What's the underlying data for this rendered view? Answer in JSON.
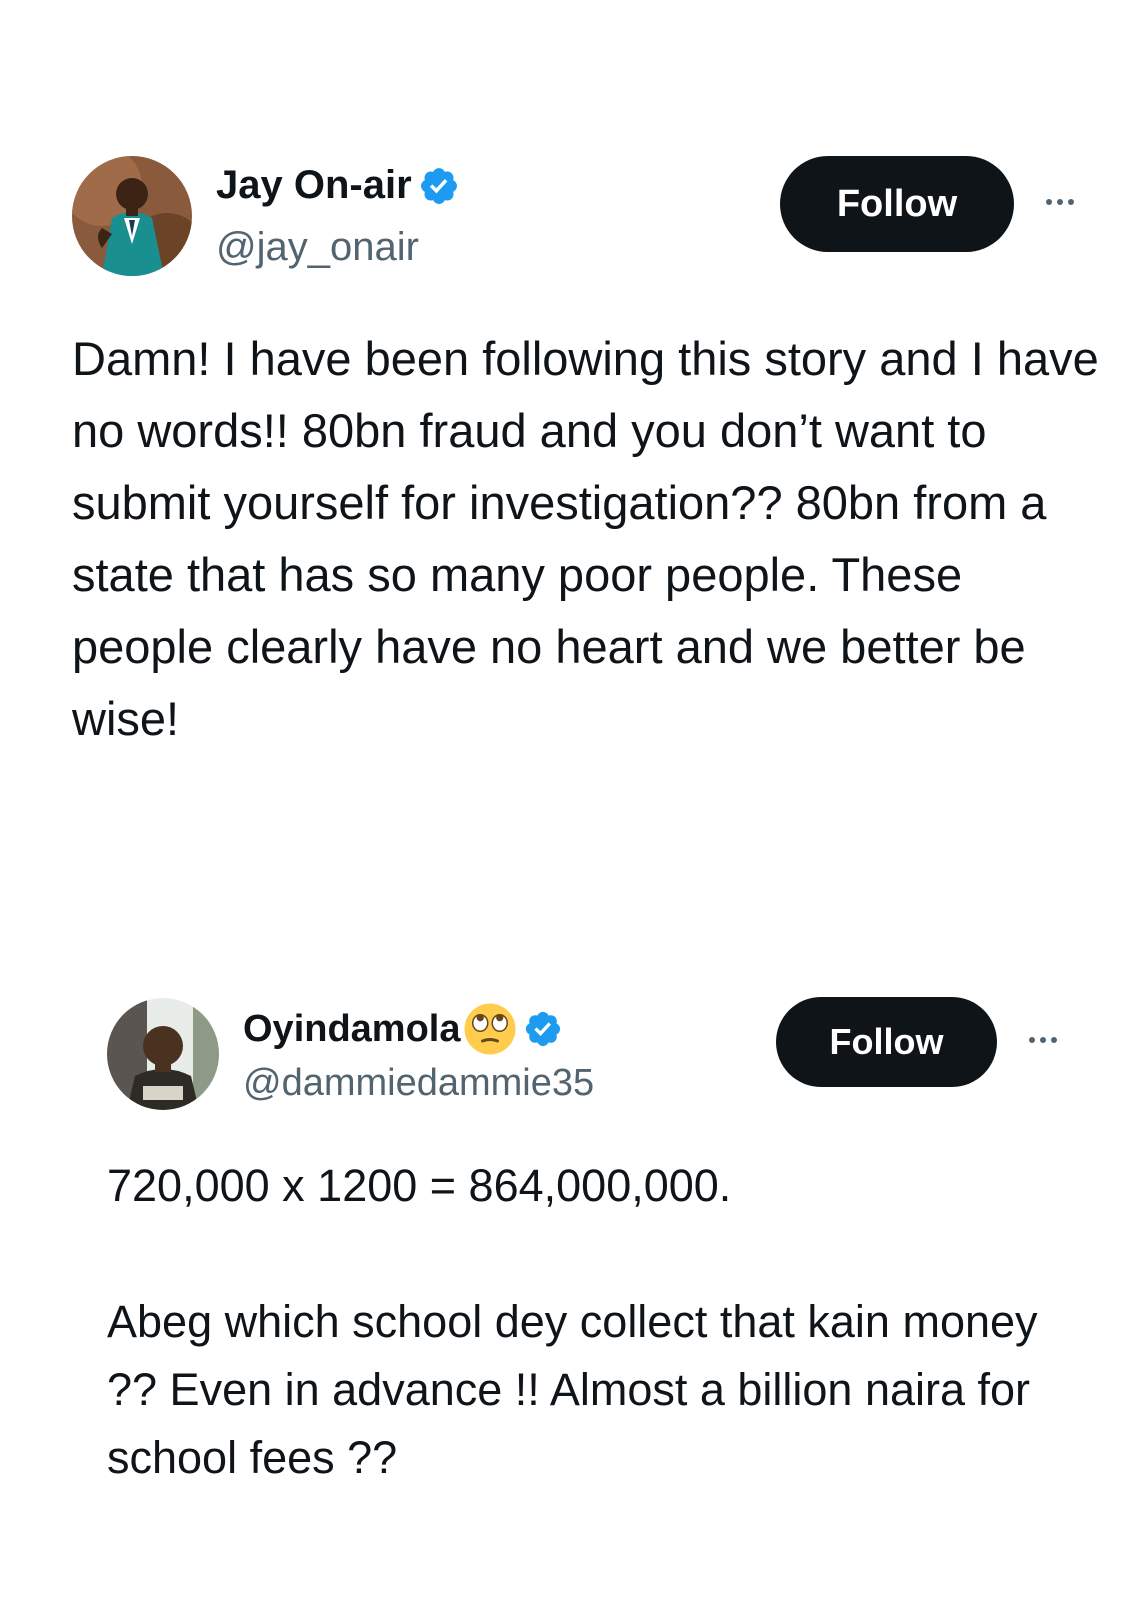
{
  "tweets": [
    {
      "avatar": "profile-photo",
      "display_name": "Jay On-air",
      "verified_icon": "verified-badge-icon",
      "handle": "@jay_onair",
      "follow_label": "Follow",
      "more_icon": "more-options-icon",
      "text": "Damn! I have been following this story and I have no words!! 80bn fraud and you don’t want to submit yourself for investigation?? 80bn from a state that has so many poor people. These people clearly have no heart and we better be wise!"
    },
    {
      "avatar": "profile-photo",
      "display_name": "Oyindamola",
      "name_emoji": "face-with-rolling-eyes-emoji",
      "verified_icon": "verified-badge-icon",
      "handle": "@dammiedammie35",
      "follow_label": "Follow",
      "more_icon": "more-options-icon",
      "text": "720,000 x 1200 =  864,000,000.\n\nAbeg which school dey collect that kain money ?? Even in advance !! Almost a billion naira for school fees ??"
    }
  ],
  "colors": {
    "text": "#0f1419",
    "secondary_text": "#536471",
    "verified_blue": "#1d9bf0",
    "follow_bg": "#0f1419",
    "follow_text": "#ffffff",
    "background": "#ffffff"
  }
}
